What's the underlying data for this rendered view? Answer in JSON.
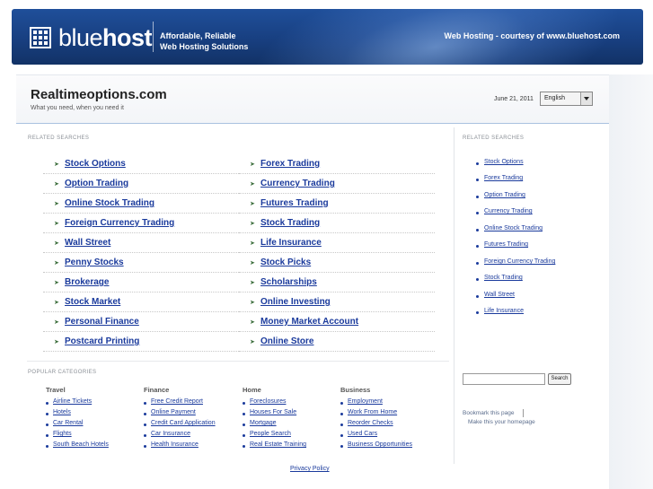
{
  "banner": {
    "logo_light": "blue",
    "logo_bold": "host",
    "tagline_line1": "Affordable, Reliable",
    "tagline_line2": "Web Hosting Solutions",
    "courtesy": "Web Hosting - courtesy of www.bluehost.com"
  },
  "header": {
    "title": "Realtimeoptions.com",
    "subtitle": "What you need, when you need it",
    "date": "June 21, 2011",
    "language": "English"
  },
  "labels": {
    "related_main": "RELATED SEARCHES",
    "related_side": "RELATED SEARCHES",
    "popular": "POPULAR CATEGORIES"
  },
  "related_left": [
    "Stock Options",
    "Option Trading",
    "Online Stock Trading",
    "Foreign Currency Trading",
    "Wall Street",
    "Penny Stocks",
    "Brokerage",
    "Stock Market",
    "Personal Finance",
    "Postcard Printing"
  ],
  "related_right": [
    "Forex Trading",
    "Currency Trading",
    "Futures Trading",
    "Stock Trading",
    "Life Insurance",
    "Stock Picks",
    "Scholarships",
    "Online Investing",
    "Money Market Account",
    "Online Store"
  ],
  "sidebar_related": [
    "Stock Options",
    "Forex Trading",
    "Option Trading",
    "Currency Trading",
    "Online Stock Trading",
    "Futures Trading",
    "Foreign Currency Trading",
    "Stock Trading",
    "Wall Street",
    "Life Insurance"
  ],
  "search": {
    "button": "Search"
  },
  "bookmark": {
    "bookmark": "Bookmark this page",
    "homepage": "Make this your homepage"
  },
  "categories": [
    {
      "name": "Travel",
      "items": [
        "Airline Tickets",
        "Hotels",
        "Car Rental",
        "Flights",
        "South Beach Hotels"
      ]
    },
    {
      "name": "Finance",
      "items": [
        "Free Credit Report",
        "Online Payment",
        "Credit Card Application",
        "Car Insurance",
        "Health Insurance"
      ]
    },
    {
      "name": "Home",
      "items": [
        "Foreclosures",
        "Houses For Sale",
        "Mortgage",
        "People Search",
        "Real Estate Training"
      ]
    },
    {
      "name": "Business",
      "items": [
        "Employment",
        "Work From Home",
        "Reorder Checks",
        "Used Cars",
        "Business Opportunities"
      ]
    }
  ],
  "footer": {
    "privacy": "Privacy Policy"
  }
}
